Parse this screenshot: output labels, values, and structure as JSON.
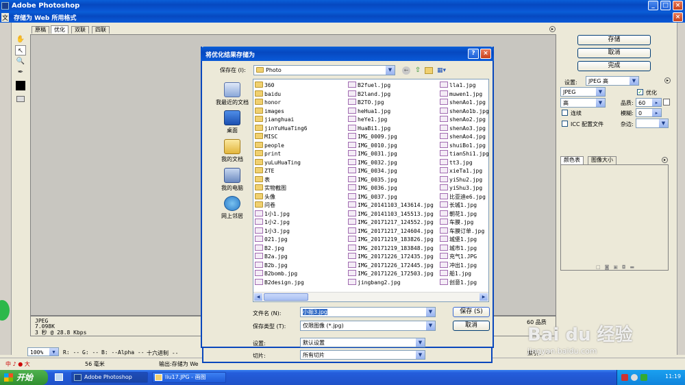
{
  "app": {
    "title": "Adobe Photoshop",
    "menu_label": "文",
    "window_title": "存储为 Web 所用格式"
  },
  "tabs": [
    "原稿",
    "优化",
    "双联",
    "四联"
  ],
  "preview_info": {
    "format": "JPEG",
    "size": "7.098K",
    "time": "3 秒 @ 28.8 Kbps",
    "quality": "60 品质"
  },
  "status_bar": {
    "zoom": "100%",
    "r": "R: --",
    "g": "G: --",
    "b": "B: --",
    "alpha": "Alpha --",
    "hex": "十六进制 --",
    "index": "索引: --"
  },
  "right_panel": {
    "save": "存储",
    "cancel": "取消",
    "done": "完成",
    "settings_label": "设置:",
    "settings_value": "JPEG 高",
    "format": "JPEG",
    "optimize_label": "优化",
    "quality_level": "高",
    "quality_label": "品质:",
    "quality_value": "60",
    "progressive_label": "连续",
    "blur_label": "模糊:",
    "blur_value": "0",
    "icc_label": "ICC 配置文件",
    "matte_label": "杂边:",
    "tab_color": "颜色表",
    "tab_size": "图像大小"
  },
  "dialog": {
    "title": "将优化结果存储为",
    "help": "?",
    "close": "×",
    "save_in_label": "保存在 (I):",
    "save_in_value": "Photo",
    "places": [
      "我最近的文档",
      "桌面",
      "我的文档",
      "我的电脑",
      "网上邻居"
    ],
    "files_col1": [
      "360",
      "baidu",
      "honor",
      "images",
      "jianghuai",
      "jinYuHuaTing6",
      "MISC",
      "people",
      "print",
      "yuLuHuaTing",
      "ZTE",
      "表",
      "实物截图",
      "头像",
      "问卷",
      "1小1.jpg",
      "1小2.jpg",
      "1小3.jpg",
      "021.jpg",
      "B2.jpg",
      "B2a.jpg",
      "B2b.jpg",
      "B2bomb.jpg",
      "B2design.jpg"
    ],
    "files_col2": [
      "B2fuel.jpg",
      "B2land.jpg",
      "B2TO.jpg",
      "heHua1.jpg",
      "heYe1.jpg",
      "HuaBi1.jpg",
      "IMG_0009.jpg",
      "IMG_0010.jpg",
      "IMG_0031.jpg",
      "IMG_0032.jpg",
      "IMG_0034.jpg",
      "IMG_0035.jpg",
      "IMG_0036.jpg",
      "IMG_0037.jpg",
      "IMG_20141103_143614.jpg",
      "IMG_20141103_145513.jpg",
      "IMG_20171217_124552.jpg",
      "IMG_20171217_124604.jpg",
      "IMG_20171219_183826.jpg",
      "IMG_20171219_183848.jpg",
      "IMG_20171226_172435.jpg",
      "IMG_20171226_172445.jpg",
      "IMG_20171226_172503.jpg",
      "jingbang2.jpg"
    ],
    "files_col3": [
      "lla1.jpg",
      "muwen1.jpg",
      "shenAo1.jpg",
      "shenAo1b.jpg",
      "shenAo2.jpg",
      "shenAo3.jpg",
      "shenAo4.jpg",
      "shuiBo1.jpg",
      "tianShi1.jpg",
      "tt3.jpg",
      "xieTa1.jpg",
      "yiShu2.jpg",
      "yiShu3.jpg",
      "比亚迪e6.jpg",
      "长城1.jpg",
      "朝花1.jpg",
      "车膜.jpg",
      "车膜订单.jpg",
      "城堡1.jpg",
      "城市1.jpg",
      "充气1.JPG",
      "冲出1.jpg",
      "船1.jpg",
      "创意1.jpg"
    ],
    "filename_label": "文件名 (N):",
    "filename_value": "小振3.jpg",
    "filetype_label": "保存类型 (T):",
    "filetype_value": "仅限图像 (*.jpg)",
    "save_btn": "保存 (S)",
    "cancel_btn": "取消",
    "settings_label": "设置:",
    "settings_value": "默认设置",
    "slices_label": "切片:",
    "slices_value": "所有切片"
  },
  "taskbar": {
    "start": "开始",
    "items": [
      "Adobe Photoshop",
      "liu17.JPG - 画图"
    ],
    "clock": "11:19",
    "ps_status": "输出:存储为 We",
    "unit": "56 毫米",
    "ime": "中 ♪ ● 大"
  },
  "watermark": {
    "brand": "Bai du 经验",
    "url": "jingyan.baidu.com"
  }
}
